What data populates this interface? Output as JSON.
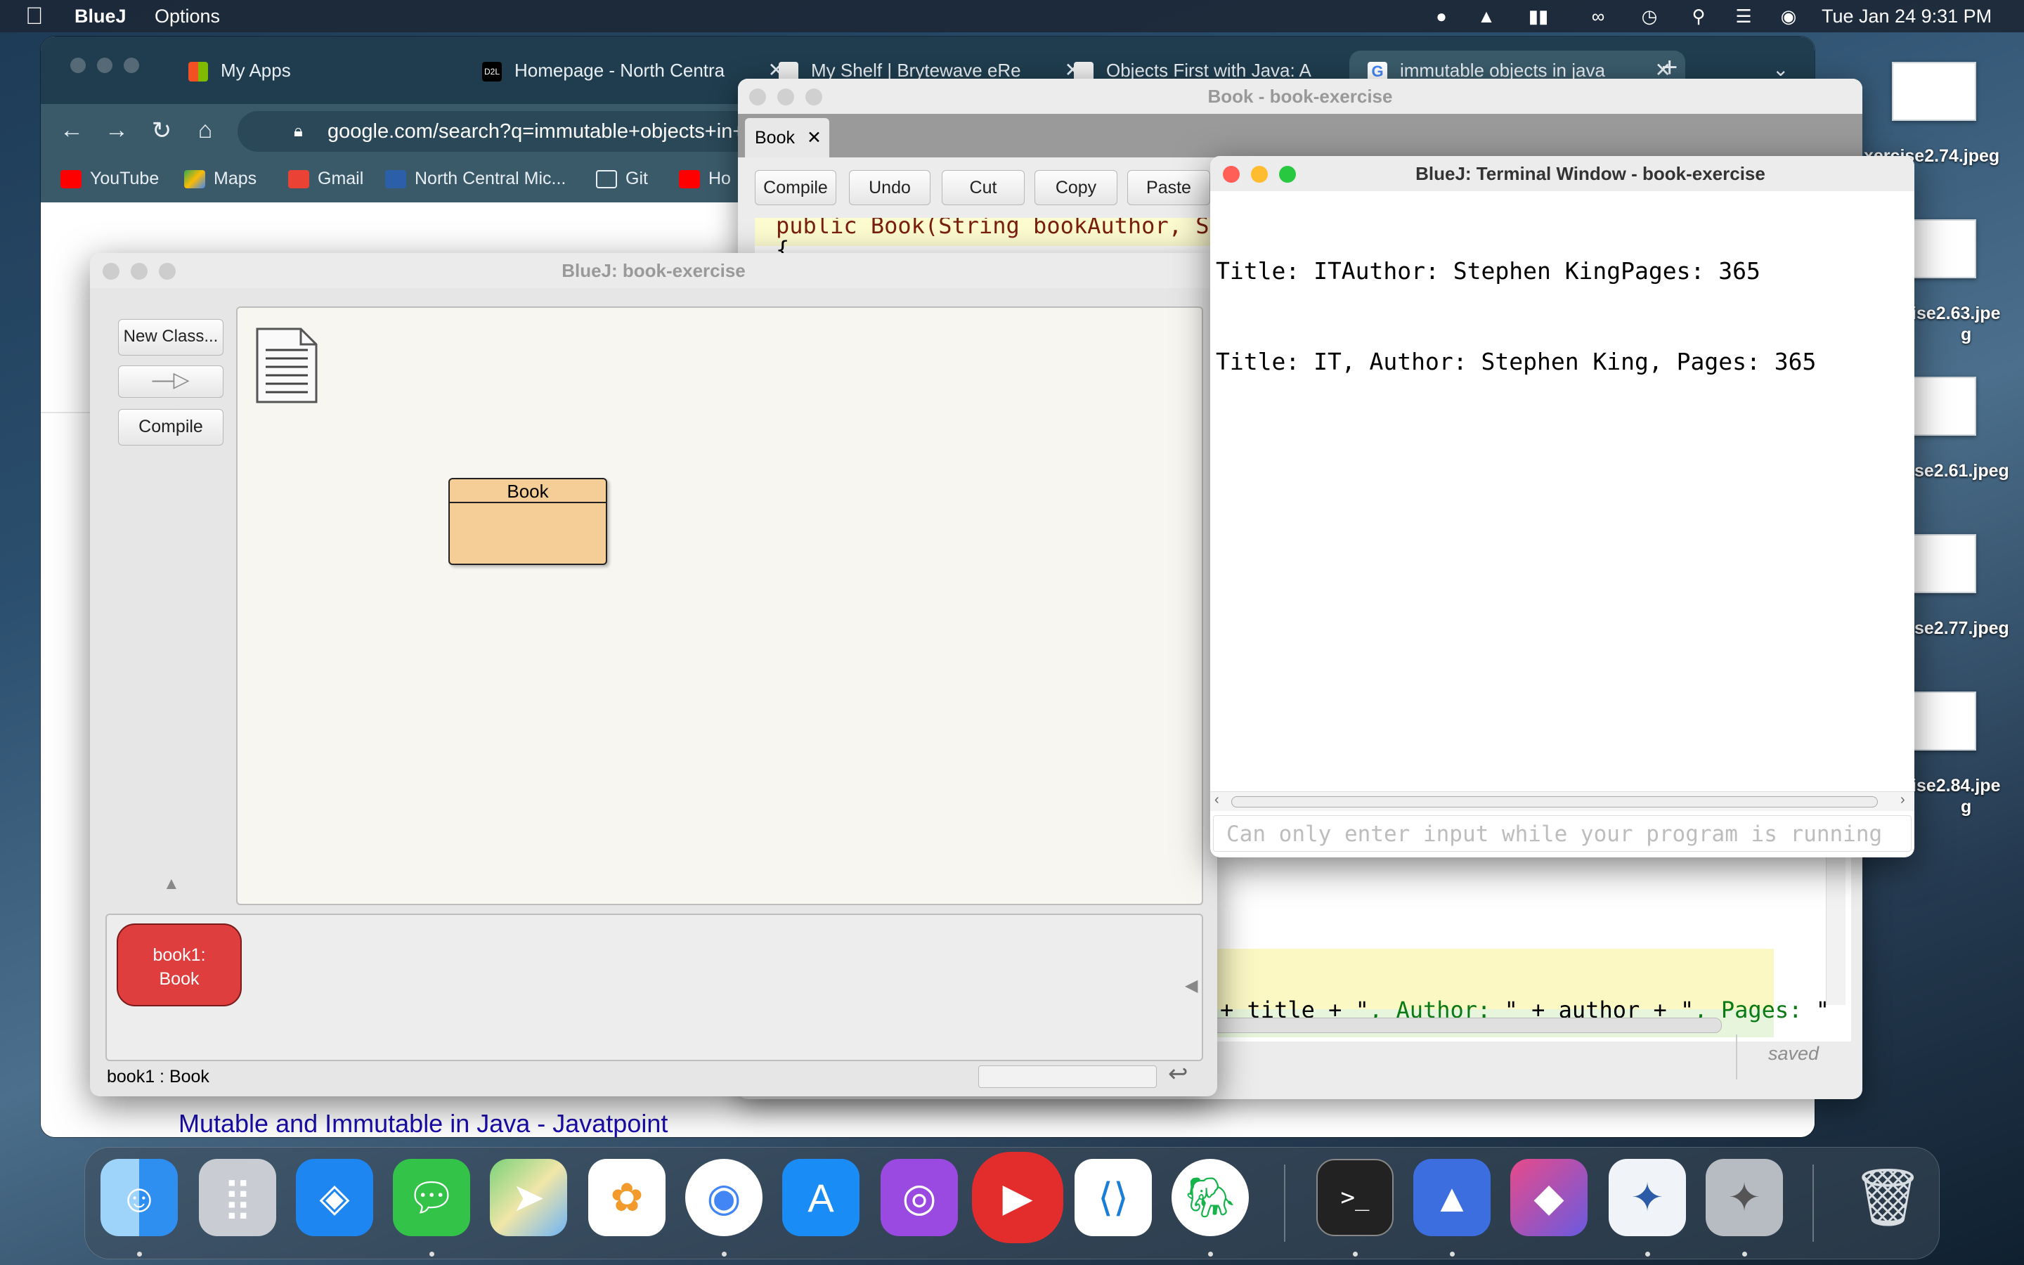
{
  "menubar": {
    "app_name": "BlueJ",
    "menu_options": "Options",
    "datetime": "Tue Jan 24  9:31 PM"
  },
  "chrome": {
    "tabs": [
      {
        "label": "My Apps"
      },
      {
        "label": "Homepage - North Centra"
      },
      {
        "label": "My Shelf | Brytewave eRe"
      },
      {
        "label": "Objects First with Java: A"
      },
      {
        "label": "immutable objects in java"
      }
    ],
    "url": "google.com/search?q=immutable+objects+in+jav",
    "bookmarks": [
      "YouTube",
      "Maps",
      "Gmail",
      "North Central Mic...",
      "Git",
      "Ho"
    ],
    "result_link": "Mutable and Immutable in Java - Javatpoint"
  },
  "editor": {
    "title": "Book - book-exercise",
    "tab_label": "Book",
    "buttons": {
      "compile": "Compile",
      "undo": "Undo",
      "cut": "Cut",
      "copy": "Copy",
      "paste": "Paste"
    },
    "code_top": "public Book(String bookAuthor, St",
    "code_brace": "{",
    "code_line_left": "+ title + \"",
    "code_str1": ", Author: ",
    "code_mid": "\" + author + \"",
    "code_str2": ", Pages: ",
    "code_end": "\"",
    "status": "saved"
  },
  "bluej": {
    "title": "BlueJ:  book-exercise",
    "new_class": "New Class...",
    "compile": "Compile",
    "class_name": "Book",
    "object_label_line1": "book1:",
    "object_label_line2": "Book",
    "status_text": "book1 : Book"
  },
  "terminal": {
    "title": "BlueJ: Terminal Window - book-exercise",
    "lines": [
      "Title: ITAuthor: Stephen KingPages: 365",
      "Title: IT, Author: Stephen King, Pages: 365"
    ],
    "input_placeholder": "Can only enter input while your program is running"
  },
  "desktop": {
    "files": [
      "xercise2.74.jpeg",
      "ise2.63.jpe",
      "g",
      "se2.61.jpeg",
      "se2.77.jpeg",
      "ise2.84.jpe",
      "g"
    ]
  },
  "dock": {
    "apps": [
      "finder-icon",
      "launchpad-icon",
      "safari-icon",
      "messages-icon",
      "maps-icon",
      "photos-icon",
      "chrome-icon",
      "app-store-icon",
      "podcasts-icon",
      "youtube-icon",
      "vscode-icon",
      "evernote-icon",
      "terminal-icon",
      "nordvpn-icon",
      "shortcuts-icon",
      "bluej-icon",
      "bluej-gray-icon",
      "trash-icon"
    ]
  }
}
